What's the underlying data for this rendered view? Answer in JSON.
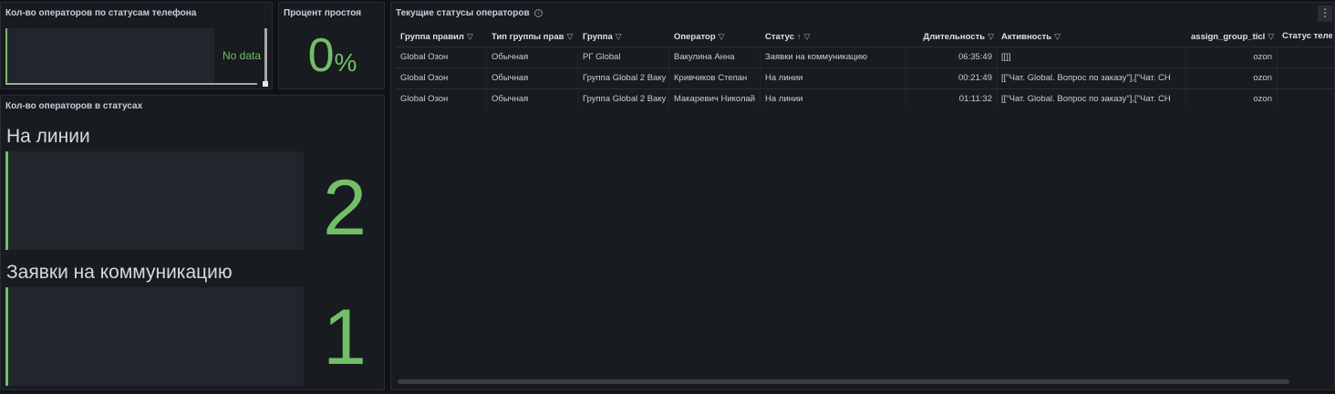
{
  "panels": {
    "phone_status": {
      "title": "Кол-во операторов по статусам телефона",
      "no_data": "No data"
    },
    "idle_percent": {
      "title": "Процент простоя",
      "value": "0",
      "unit": "%"
    },
    "ops_in_status": {
      "title": "Кол-во операторов в статусах",
      "items": [
        {
          "label": "На линии",
          "value": "2"
        },
        {
          "label": "Заявки на коммуникацию",
          "value": "1"
        }
      ]
    },
    "current_statuses": {
      "title": "Текущие статусы операторов",
      "info_icon": "i",
      "menu_icon": "⋮",
      "columns": [
        {
          "label": "Группа правил",
          "filter": "▽"
        },
        {
          "label": "Тип группы прав",
          "filter": "▽"
        },
        {
          "label": "Группа",
          "filter": "▽"
        },
        {
          "label": "Оператор",
          "filter": "▽"
        },
        {
          "label": "Статус",
          "sort": "↑",
          "filter": "▽"
        },
        {
          "label": "Длительность",
          "filter": "▽"
        },
        {
          "label": "Активность",
          "filter": "▽"
        },
        {
          "label": "assign_group_ticl",
          "filter": "▽"
        },
        {
          "label": "Статус теле",
          "filter": ""
        }
      ],
      "rows": [
        [
          "Global Озон",
          "Обычная",
          "РГ Global",
          "Вакулина Анна",
          "Заявки на коммуникацию",
          "06:35:49",
          "[[]]",
          "ozon",
          ""
        ],
        [
          "Global Озон",
          "Обычная",
          "Группа Global 2 Ваку",
          "Кривчиков Степан",
          "На линии",
          "00:21:49",
          "[[\"Чат. Global. Вопрос по заказу\"],[\"Чат. СН",
          "ozon",
          ""
        ],
        [
          "Global Озон",
          "Обычная",
          "Группа Global 2 Ваку",
          "Макаревич Николай",
          "На линии",
          "01:11:32",
          "[[\"Чат. Global. Вопрос по заказу\"],[\"Чат. СН",
          "ozon",
          ""
        ]
      ]
    }
  },
  "colors": {
    "accent_green": "#73bf69",
    "panel_bg": "#181b1f",
    "page_bg": "#111217"
  }
}
